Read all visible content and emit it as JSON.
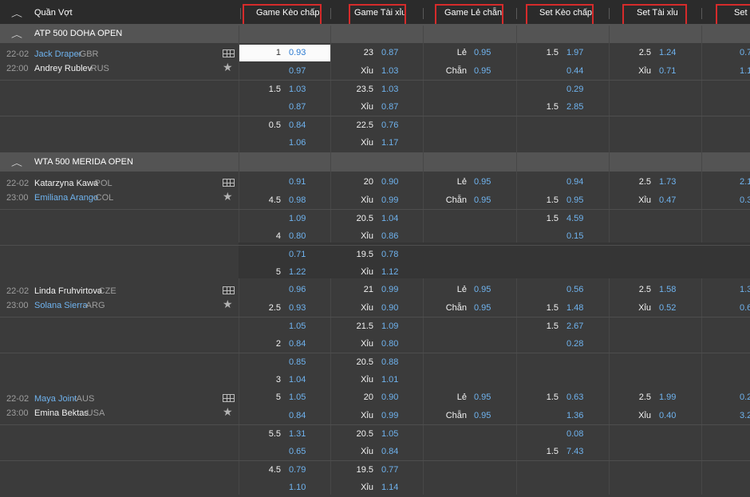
{
  "header": {
    "sport": "Quần Vợt",
    "columns": [
      "Game Kèo chấp",
      "Game Tài xỉu",
      "Game Lẻ chẵn",
      "Set Kèo chấp",
      "Set Tài xỉu",
      "Set Lẻ"
    ]
  },
  "accent_colors": {
    "odds": "#6fb3ef",
    "highlight_box": "#d62b2b",
    "league_bar": "#545454"
  },
  "leagues": [
    {
      "name": "ATP 500 DOHA OPEN"
    },
    {
      "name": "WTA 500 MERIDA OPEN"
    }
  ],
  "matches": [
    {
      "date": "22-02",
      "time": "22:00",
      "home": {
        "name": "Jack Draper",
        "country": "-GBR"
      },
      "away": {
        "name": "Andrey Rublev",
        "country": "-RUS"
      }
    },
    {
      "date": "22-02",
      "time": "23:00",
      "home": {
        "name": "Katarzyna Kawa",
        "country": "-POL"
      },
      "away": {
        "name": "Emiliana Arango",
        "country": "-COL"
      }
    },
    {
      "date": "22-02",
      "time": "23:00",
      "home": {
        "name": "Linda Fruhvirtova",
        "country": "-CZE"
      },
      "away": {
        "name": "Solana Sierra",
        "country": "-ARG"
      }
    },
    {
      "date": "22-02",
      "time": "23:00",
      "home": {
        "name": "Maya Joint",
        "country": "-AUS"
      },
      "away": {
        "name": "Emina Bektas",
        "country": "-USA"
      }
    }
  ],
  "odds": [
    [
      "1",
      "0.93",
      "23",
      "0.87",
      "Lẻ",
      "0.95",
      "1.5",
      "1.97",
      "2.5",
      "1.24",
      "0.7"
    ],
    [
      "",
      "0.97",
      "Xỉu",
      "1.03",
      "Chẵn",
      "0.95",
      "",
      "0.44",
      "Xỉu",
      "0.71",
      "1.1"
    ],
    [
      "1.5",
      "1.03",
      "23.5",
      "1.03",
      "",
      "",
      "",
      "0.29",
      "",
      "",
      ""
    ],
    [
      "",
      "0.87",
      "Xỉu",
      "0.87",
      "",
      "",
      "1.5",
      "2.85",
      "",
      "",
      ""
    ],
    [
      "0.5",
      "0.84",
      "22.5",
      "0.76",
      "",
      "",
      "",
      "",
      "",
      "",
      ""
    ],
    [
      "",
      "1.06",
      "Xỉu",
      "1.17",
      "",
      "",
      "",
      "",
      "",
      "",
      ""
    ],
    [
      "",
      "0.91",
      "20",
      "0.90",
      "Lẻ",
      "0.95",
      "",
      "0.94",
      "2.5",
      "1.73",
      "2.1"
    ],
    [
      "4.5",
      "0.98",
      "Xỉu",
      "0.99",
      "Chẵn",
      "0.95",
      "1.5",
      "0.95",
      "Xỉu",
      "0.47",
      "0.3"
    ],
    [
      "",
      "1.09",
      "20.5",
      "1.04",
      "",
      "",
      "1.5",
      "4.59",
      "",
      "",
      ""
    ],
    [
      "4",
      "0.80",
      "Xỉu",
      "0.86",
      "",
      "",
      "",
      "0.15",
      "",
      "",
      ""
    ],
    [
      "",
      "0.71",
      "19.5",
      "0.78",
      "",
      "",
      "",
      "",
      "",
      "",
      ""
    ],
    [
      "5",
      "1.22",
      "Xỉu",
      "1.12",
      "",
      "",
      "",
      "",
      "",
      "",
      ""
    ],
    [
      "",
      "0.96",
      "21",
      "0.99",
      "Lẻ",
      "0.95",
      "",
      "0.56",
      "2.5",
      "1.58",
      "1.3"
    ],
    [
      "2.5",
      "0.93",
      "Xỉu",
      "0.90",
      "Chẵn",
      "0.95",
      "1.5",
      "1.48",
      "Xỉu",
      "0.52",
      "0.6"
    ],
    [
      "",
      "1.05",
      "21.5",
      "1.09",
      "",
      "",
      "1.5",
      "2.67",
      "",
      "",
      ""
    ],
    [
      "2",
      "0.84",
      "Xỉu",
      "0.80",
      "",
      "",
      "",
      "0.28",
      "",
      "",
      ""
    ],
    [
      "",
      "0.85",
      "20.5",
      "0.88",
      "",
      "",
      "",
      "",
      "",
      "",
      ""
    ],
    [
      "3",
      "1.04",
      "Xỉu",
      "1.01",
      "",
      "",
      "",
      "",
      "",
      "",
      ""
    ],
    [
      "5",
      "1.05",
      "20",
      "0.90",
      "Lẻ",
      "0.95",
      "1.5",
      "0.63",
      "2.5",
      "1.99",
      "0.2"
    ],
    [
      "",
      "0.84",
      "Xỉu",
      "0.99",
      "Chẵn",
      "0.95",
      "",
      "1.36",
      "Xỉu",
      "0.40",
      "3.2"
    ],
    [
      "5.5",
      "1.31",
      "20.5",
      "1.05",
      "",
      "",
      "",
      "0.08",
      "",
      "",
      ""
    ],
    [
      "",
      "0.65",
      "Xỉu",
      "0.84",
      "",
      "",
      "1.5",
      "7.43",
      "",
      "",
      ""
    ],
    [
      "4.5",
      "0.79",
      "19.5",
      "0.77",
      "",
      "",
      "",
      "",
      "",
      "",
      ""
    ],
    [
      "",
      "1.10",
      "Xỉu",
      "1.14",
      "",
      "",
      "",
      "",
      "",
      "",
      ""
    ]
  ]
}
